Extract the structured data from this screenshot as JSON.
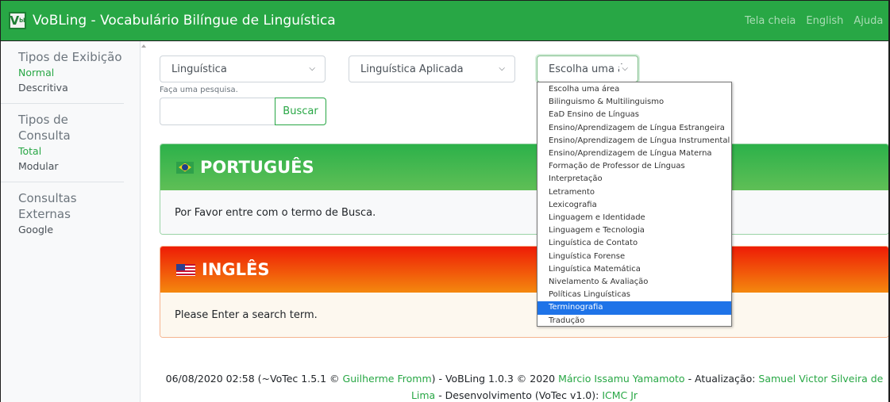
{
  "navbar": {
    "logo_text": "V",
    "logo_sub": "bl",
    "title": "VoBLing - Vocabulário Bilíngue de Linguística",
    "links": [
      "Tela cheia",
      "English",
      "Ajuda"
    ]
  },
  "sidebar": {
    "groups": [
      {
        "heading": "Tipos de Exibição",
        "items": [
          {
            "label": "Normal",
            "active": true
          },
          {
            "label": "Descritiva",
            "active": false
          }
        ]
      },
      {
        "heading": "Tipos de Consulta",
        "items": [
          {
            "label": "Total",
            "active": true
          },
          {
            "label": "Modular",
            "active": false
          }
        ]
      },
      {
        "heading": "Consultas Externas",
        "items": [
          {
            "label": "Google",
            "active": false
          }
        ]
      }
    ]
  },
  "filters": {
    "select1": "Linguística",
    "select2": "Linguística Aplicada",
    "select3": "Escolha uma á"
  },
  "search": {
    "hint": "Faça uma pesquisa.",
    "value": "",
    "button_label": "Buscar"
  },
  "cards": {
    "portuguese": {
      "title": "PORTUGUÊS",
      "message": "Por Favor entre com o termo de Busca."
    },
    "english": {
      "title": "INGLÊS",
      "message": "Please Enter a search term."
    }
  },
  "dropdown": {
    "options": [
      "Escolha uma área",
      "Bilinguismo & Multilinguismo",
      "EaD Ensino de Línguas",
      "Ensino/Aprendizagem de Língua Estrangeira",
      "Ensino/Aprendizagem de Língua Instrumental",
      "Ensino/Aprendizagem de Língua Materna",
      "Formação de Professor de Línguas",
      "Interpretação",
      "Letramento",
      "Lexicografia",
      "Linguagem e Identidade",
      "Linguagem e Tecnologia",
      "Linguística de Contato",
      "Linguística Forense",
      "Linguística Matemática",
      "Nivelamento & Avaliação",
      "Políticas Linguísticas",
      "Terminografia",
      "Tradução"
    ],
    "highlighted": "Terminografia"
  },
  "footer": {
    "part1": "06/08/2020 02:58 (~VoTec 1.5.1 © ",
    "link1": "Guilherme Fromm",
    "part2": ") - VoBLing 1.0.3 © 2020 ",
    "link2": "Márcio Issamu Yamamoto",
    "part3": " - Atualização: ",
    "link3": "Samuel Victor Silveira de Lima",
    "part4": " - Desenvolvimento (VoTec v1.0): ",
    "link4": "ICMC Jr"
  },
  "colors": {
    "brand": "#28a745",
    "highlight": "#1e73e8",
    "english_header": "#ee1c06"
  }
}
